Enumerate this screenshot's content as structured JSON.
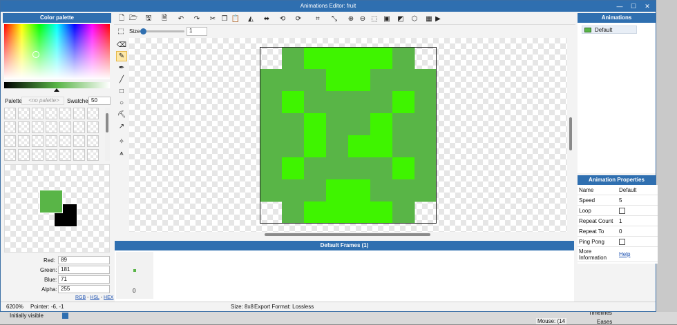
{
  "window": {
    "title": "Animations Editor: fruit",
    "minimize": "—",
    "maximize": "☐",
    "close": "✕"
  },
  "color_palette": {
    "title": "Color palette",
    "palette_label": "Palette",
    "palette_value": "<no palette>",
    "swatches_label": "Swatches",
    "swatches_value": "50"
  },
  "color": {
    "red_label": "Red:",
    "red": "89",
    "green_label": "Green:",
    "green": "181",
    "blue_label": "Blue:",
    "blue": "71",
    "alpha_label": "Alpha:",
    "alpha": "255",
    "primary_hex": "#59b547",
    "secondary_hex": "#000000",
    "rgb_link": "RGB",
    "hsl_link": "HSL",
    "hex_link": "HEX",
    "sep1": "-",
    "sep2": "-"
  },
  "toolbar": {
    "size_label": "Size",
    "size_value": "1",
    "size_slider_fraction": 0.0
  },
  "canvas": {
    "grid_size": 8,
    "pixels": [
      "TGLLLLGT",
      "GGGLLGGG",
      "GLGGGGLG",
      "GGLGGLGG",
      "GGLGLLGG",
      "GLGGGGLG",
      "GGGLLGGG",
      "TGLLLLGT"
    ],
    "color_G": "#59b547",
    "color_L": "#3ff400"
  },
  "frames": {
    "title": "Default Frames (1)",
    "frame_index": "0"
  },
  "animations": {
    "title": "Animations",
    "items": [
      {
        "name": "Default"
      }
    ]
  },
  "anim_props": {
    "title": "Animation Properties",
    "name_label": "Name",
    "name": "Default",
    "speed_label": "Speed",
    "speed": "5",
    "loop_label": "Loop",
    "repeat_count_label": "Repeat Count",
    "repeat_count": "1",
    "repeat_to_label": "Repeat To",
    "repeat_to": "0",
    "ping_pong_label": "Ping Pong",
    "more_label": "More Information",
    "help": "Help"
  },
  "status": {
    "zoom": "6200%",
    "pointer": "Pointer: -6, -1",
    "size": "Size: 8x8",
    "export": "Export Format: Lossless"
  },
  "background": {
    "initially_visible": "Initially visible",
    "mouse": "Mouse: (14",
    "timelines": "Timelines",
    "eases": "Eases"
  },
  "icons": [
    "new-icon",
    "open-icon",
    "save-icon",
    "save-all-icon",
    "undo-icon",
    "redo-icon",
    "cut-icon",
    "copy-icon",
    "paste-icon",
    "flip-horizontal-icon",
    "flip-vertical-icon",
    "rotate-left-icon",
    "rotate-right-icon",
    "crop-icon",
    "resize-icon",
    "zoom-in-icon",
    "zoom-out-icon",
    "zoom-fit-icon",
    "zoom-actual-icon",
    "color-adjust-icon",
    "layers-icon",
    "grid-icon",
    "play-icon"
  ]
}
